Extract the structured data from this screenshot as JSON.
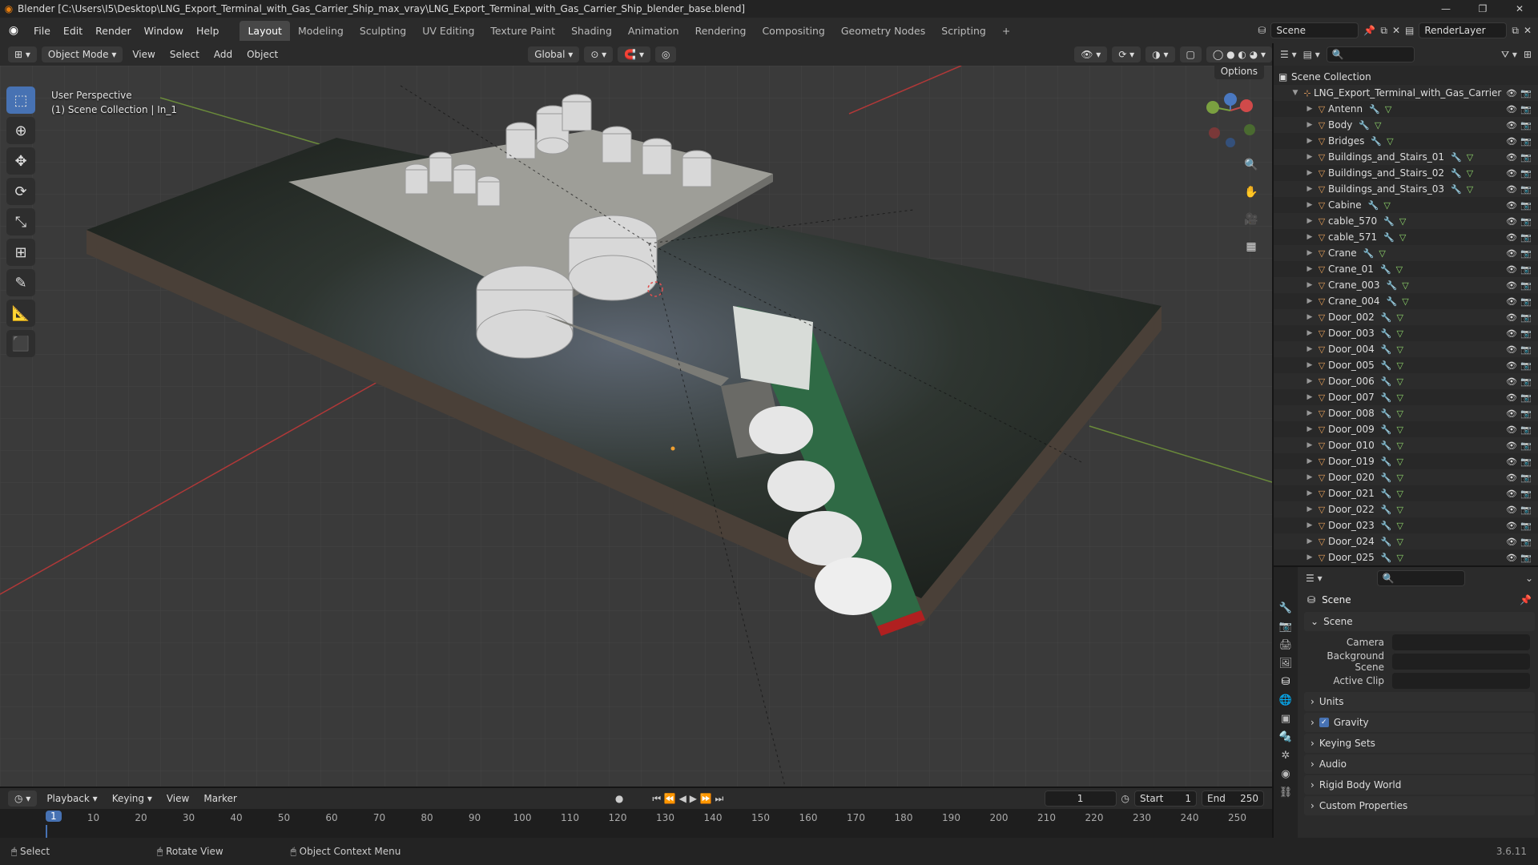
{
  "window": {
    "title": "Blender [C:\\Users\\I5\\Desktop\\LNG_Export_Terminal_with_Gas_Carrier_Ship_max_vray\\LNG_Export_Terminal_with_Gas_Carrier_Ship_blender_base.blend]"
  },
  "menu": [
    "File",
    "Edit",
    "Render",
    "Window",
    "Help"
  ],
  "workspace_tabs": [
    {
      "label": "Layout",
      "active": true
    },
    {
      "label": "Modeling"
    },
    {
      "label": "Sculpting"
    },
    {
      "label": "UV Editing"
    },
    {
      "label": "Texture Paint"
    },
    {
      "label": "Shading"
    },
    {
      "label": "Animation"
    },
    {
      "label": "Rendering"
    },
    {
      "label": "Compositing"
    },
    {
      "label": "Geometry Nodes"
    },
    {
      "label": "Scripting"
    },
    {
      "label": "+"
    }
  ],
  "scene_selector": "Scene",
  "render_layer": "RenderLayer",
  "viewport_header": {
    "mode": "Object Mode",
    "menus": [
      "View",
      "Select",
      "Add",
      "Object"
    ],
    "transform_orientation": "Global",
    "options_label": "Options"
  },
  "viewport": {
    "perspective": "User Perspective",
    "collection_info": "(1) Scene Collection | In_1"
  },
  "tools": [
    "select-box",
    "cursor",
    "move",
    "rotate",
    "scale",
    "transform",
    "annotate",
    "measure",
    "add-cube"
  ],
  "outliner": {
    "root": "Scene Collection",
    "main_object": "LNG_Export_Terminal_with_Gas_Carrier",
    "items": [
      "Antenn",
      "Body",
      "Bridges",
      "Buildings_and_Stairs_01",
      "Buildings_and_Stairs_02",
      "Buildings_and_Stairs_03",
      "Cabine",
      "cable_570",
      "cable_571",
      "Crane",
      "Crane_01",
      "Crane_003",
      "Crane_004",
      "Door_002",
      "Door_003",
      "Door_004",
      "Door_005",
      "Door_006",
      "Door_007",
      "Door_008",
      "Door_009",
      "Door_010",
      "Door_019",
      "Door_020",
      "Door_021",
      "Door_022",
      "Door_023",
      "Door_024",
      "Door_025"
    ]
  },
  "properties": {
    "context": "Scene",
    "section": "Scene",
    "fields": [
      {
        "label": "Camera",
        "value": ""
      },
      {
        "label": "Background Scene",
        "value": ""
      },
      {
        "label": "Active Clip",
        "value": ""
      }
    ],
    "panels": [
      {
        "label": "Units",
        "checkbox": false
      },
      {
        "label": "Gravity",
        "checkbox": true
      },
      {
        "label": "Keying Sets",
        "checkbox": false
      },
      {
        "label": "Audio",
        "checkbox": false
      },
      {
        "label": "Rigid Body World",
        "checkbox": false
      },
      {
        "label": "Custom Properties",
        "checkbox": false
      }
    ]
  },
  "timeline": {
    "menus": [
      "Playback",
      "Keying",
      "View",
      "Marker"
    ],
    "current_frame": "1",
    "start_label": "Start",
    "start": "1",
    "end_label": "End",
    "end": "250",
    "ticks": [
      "10",
      "20",
      "30",
      "40",
      "50",
      "60",
      "70",
      "80",
      "90",
      "100",
      "110",
      "120",
      "130",
      "140",
      "150",
      "160",
      "170",
      "180",
      "190",
      "200",
      "210",
      "220",
      "230",
      "240",
      "250"
    ]
  },
  "statusbar": {
    "select": "Select",
    "rotate": "Rotate View",
    "context": "Object Context Menu",
    "version": "3.6.11"
  }
}
